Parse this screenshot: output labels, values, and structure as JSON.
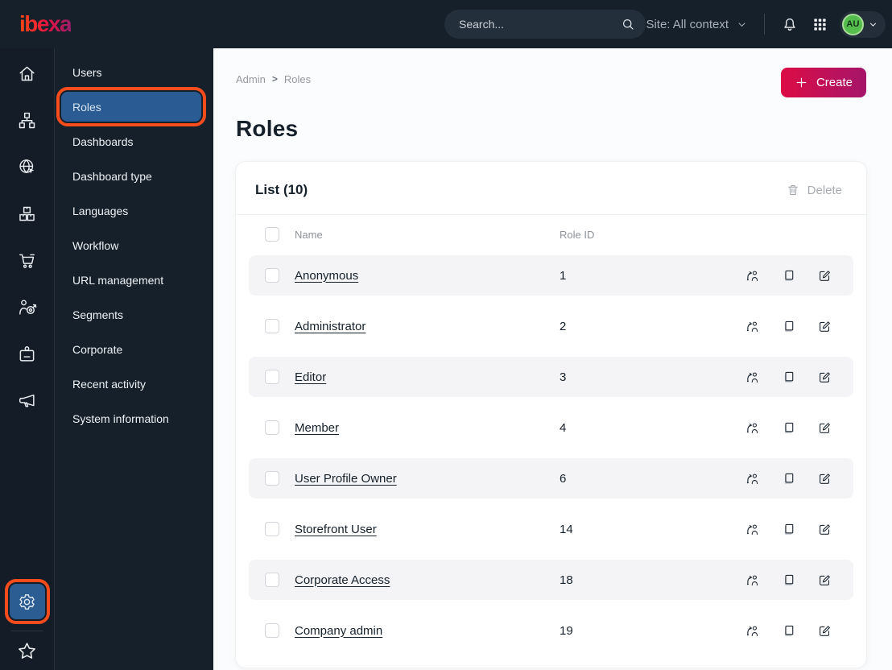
{
  "topbar": {
    "brand": "ibexa",
    "search_placeholder": "Search...",
    "site_context": "Site: All context",
    "user_initials": "AU"
  },
  "sidebar": {
    "items": [
      {
        "label": "Users",
        "data_name": "sidebar-item-users"
      },
      {
        "label": "Roles",
        "data_name": "sidebar-item-roles",
        "active": true,
        "annotated": true
      },
      {
        "label": "Dashboards",
        "data_name": "sidebar-item-dashboards"
      },
      {
        "label": "Dashboard type",
        "data_name": "sidebar-item-dashboard-type"
      },
      {
        "label": "Languages",
        "data_name": "sidebar-item-languages"
      },
      {
        "label": "Workflow",
        "data_name": "sidebar-item-workflow"
      },
      {
        "label": "URL management",
        "data_name": "sidebar-item-url-management"
      },
      {
        "label": "Segments",
        "data_name": "sidebar-item-segments"
      },
      {
        "label": "Corporate",
        "data_name": "sidebar-item-corporate"
      },
      {
        "label": "Recent activity",
        "data_name": "sidebar-item-recent-activity"
      },
      {
        "label": "System information",
        "data_name": "sidebar-item-system-information"
      }
    ]
  },
  "main": {
    "breadcrumb": [
      "Admin",
      "Roles"
    ],
    "breadcrumb_separator": ">",
    "create_label": "Create",
    "page_title": "Roles",
    "list": {
      "title": "List (10)",
      "delete_label": "Delete",
      "columns": [
        "Name",
        "Role ID"
      ],
      "rows": [
        {
          "name": "Anonymous",
          "role_id": "1"
        },
        {
          "name": "Administrator",
          "role_id": "2"
        },
        {
          "name": "Editor",
          "role_id": "3"
        },
        {
          "name": "Member",
          "role_id": "4"
        },
        {
          "name": "User Profile Owner",
          "role_id": "6"
        },
        {
          "name": "Storefront User",
          "role_id": "14"
        },
        {
          "name": "Corporate Access",
          "role_id": "18"
        },
        {
          "name": "Company admin",
          "role_id": "19"
        }
      ]
    }
  },
  "icons": {
    "rail": [
      "home-icon",
      "content-tree-icon",
      "site-globe-icon",
      "products-boxes-icon",
      "commerce-cart-icon",
      "personalization-target-icon",
      "corporate-badge-icon",
      "campaign-megaphone-icon",
      "settings-gear-icon",
      "bookmarks-star-icon"
    ],
    "topbar": [
      "search-icon",
      "globe-icon",
      "chevron-down-icon",
      "bell-icon",
      "grid-icon"
    ],
    "row_actions": [
      "assign-user-icon",
      "copy-icon",
      "edit-icon"
    ],
    "list_header": [
      "trash-icon"
    ]
  },
  "colors": {
    "topbar_bg": "#16202b",
    "rail_bg": "#141d27",
    "selected_blue": "#2a5b92",
    "annotation_orange": "#f84c1c",
    "create_gradient_start": "#dc0c45",
    "create_gradient_end": "#a6156a",
    "avatar_green": "#55bd4b",
    "row_stripe": "#f4f4f6",
    "text_dark": "#15202b"
  }
}
